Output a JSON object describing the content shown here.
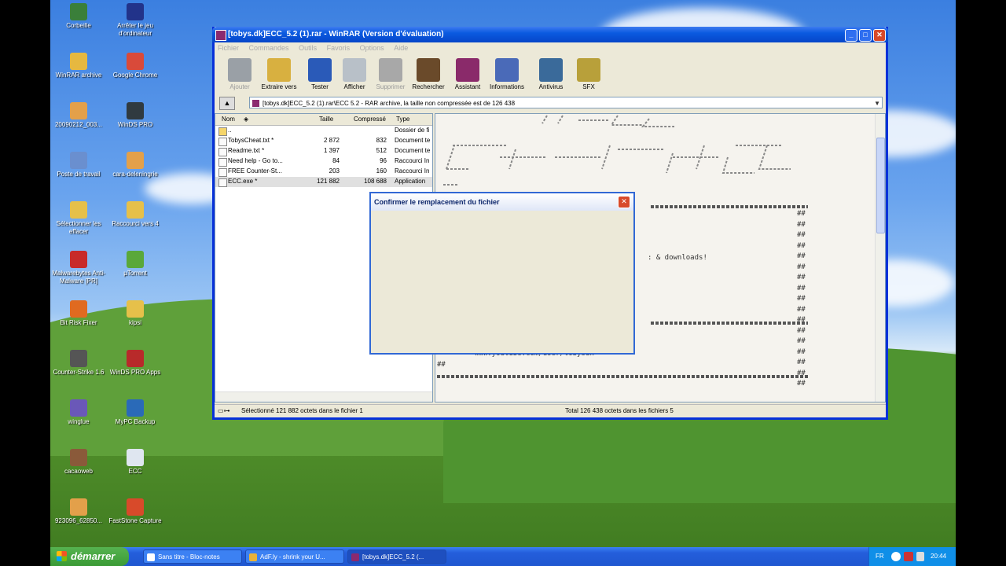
{
  "desktop": {
    "icons": [
      {
        "label": "Corbeille",
        "color": "#3a7f3a"
      },
      {
        "label": "Arrêter le jeu d'ordinateur",
        "color": "#22338a"
      },
      {
        "label": "WinRAR archive",
        "color": "#e6b840"
      },
      {
        "label": "Google Chrome",
        "color": "#d94a3a"
      },
      {
        "label": "20090212_003...",
        "color": "#e3a04a"
      },
      {
        "label": "WinDS PRO",
        "color": "#303a40"
      },
      {
        "label": "Poste de travail",
        "color": "#6a8fcf"
      },
      {
        "label": "cara-deleningrie",
        "color": "#e3a04a"
      },
      {
        "label": "Sélectionner les effacer",
        "color": "#e6c04a"
      },
      {
        "label": "Raccourci vers 4",
        "color": "#e6c04a"
      },
      {
        "label": "Malwarebytes Anti-Malware [PR]",
        "color": "#c82a2a"
      },
      {
        "label": "µTorrent",
        "color": "#5aa83a"
      },
      {
        "label": "Bit Risk Fixer",
        "color": "#e06a20"
      },
      {
        "label": "kipsi",
        "color": "#e6c04a"
      },
      {
        "label": "Counter-Strike 1.6",
        "color": "#555555"
      },
      {
        "label": "WinDS PRO Apps",
        "color": "#b82a2a"
      },
      {
        "label": "winglue",
        "color": "#6a58b8"
      },
      {
        "label": "MyPC Backup",
        "color": "#2a6ab8"
      },
      {
        "label": "cacaoweb",
        "color": "#8a5a3a"
      },
      {
        "label": "ECC",
        "color": "#dfe6f0"
      },
      {
        "label": "923096_62850...",
        "color": "#e3a04a"
      },
      {
        "label": "FastStone Capture",
        "color": "#d84a2a"
      }
    ]
  },
  "window": {
    "title": "[tobys.dk]ECC_5.2 (1).rar - WinRAR (Version d'évaluation)",
    "minimize": "_",
    "maximize": "□",
    "close": "✕",
    "menu": [
      "Fichier",
      "Commandes",
      "Outils",
      "Favoris",
      "Options",
      "Aide"
    ],
    "toolbar": [
      {
        "label": "Ajouter",
        "icon": "add-icon",
        "enabled": false,
        "color": "#9aa0a6"
      },
      {
        "label": "Extraire vers",
        "icon": "extract-icon",
        "enabled": true,
        "color": "#d8b040"
      },
      {
        "label": "Tester",
        "icon": "test-icon",
        "enabled": true,
        "color": "#2a5ab8"
      },
      {
        "label": "Afficher",
        "icon": "view-icon",
        "enabled": true,
        "color": "#b8c0c8"
      },
      {
        "label": "Supprimer",
        "icon": "delete-icon",
        "enabled": false,
        "color": "#a8a8a8"
      },
      {
        "label": "Rechercher",
        "icon": "find-icon",
        "enabled": true,
        "color": "#6a4a2a"
      },
      {
        "label": "Assistant",
        "icon": "wizard-icon",
        "enabled": true,
        "color": "#8a2a6a"
      },
      {
        "label": "Informations",
        "icon": "info-icon",
        "enabled": true,
        "color": "#4a6ab8"
      },
      {
        "label": "Antivirus",
        "icon": "antivirus-icon",
        "enabled": true,
        "color": "#3a6a9a"
      },
      {
        "label": "SFX",
        "icon": "sfx-icon",
        "enabled": true,
        "color": "#b8a03a"
      }
    ],
    "address": "[tobys.dk]ECC_5.2 (1).rar\\ECC 5.2 - RAR archive, la taille non compressée est de 126 438",
    "list": {
      "headers": {
        "name": "Nom",
        "size": "Taille",
        "packed": "Compressé",
        "type": "Type"
      },
      "rows": [
        {
          "name": "..",
          "size": "",
          "packed": "",
          "type": "Dossier de fi"
        },
        {
          "name": "TobysCheat.txt *",
          "size": "2 872",
          "packed": "832",
          "type": "Document te"
        },
        {
          "name": "Readme.txt *",
          "size": "1 397",
          "packed": "512",
          "type": "Document te"
        },
        {
          "name": "Need help - Go to...",
          "size": "84",
          "packed": "96",
          "type": "Raccourci In"
        },
        {
          "name": "FREE Counter-St...",
          "size": "203",
          "packed": "160",
          "type": "Raccourci In"
        },
        {
          "name": "ECC.exe *",
          "size": "121 882",
          "packed": "108 688",
          "type": "Application"
        }
      ]
    },
    "viewer": {
      "downloads_text": ": & downloads!",
      "url_text": "www.youtube.com/user/tobysdk",
      "hash_mark": "##"
    },
    "status_left": "Sélectionné 121 882 octets dans le fichier 1",
    "status_right": "Total 126 438 octets dans les fichiers 5"
  },
  "dialog": {
    "title": "Confirmer le remplacement du fichier",
    "close": "✕"
  },
  "taskbar": {
    "start_label": "démarrer",
    "tasks": [
      {
        "label": "Sans titre - Bloc-notes",
        "active": false
      },
      {
        "label": "AdF.ly - shrink your U...",
        "active": false
      },
      {
        "label": "[tobys.dk]ECC_5.2 (...",
        "active": true
      }
    ],
    "lang": "FR",
    "clock": "20:44"
  }
}
